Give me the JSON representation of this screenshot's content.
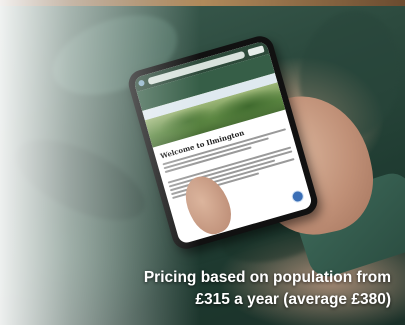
{
  "photo": {
    "subject": "hand holding smartphone showing parish council website",
    "site": {
      "browser_url": "",
      "browser_menu": "",
      "header_text": "",
      "heading": "Welcome to Ilmington"
    }
  },
  "caption": {
    "line1": "Pricing based on population from",
    "line2": "£315 a year (average £380)"
  },
  "colors": {
    "site_header": "#365e47",
    "jacket": "#2c4a3e",
    "caption_text": "#ffffff"
  }
}
